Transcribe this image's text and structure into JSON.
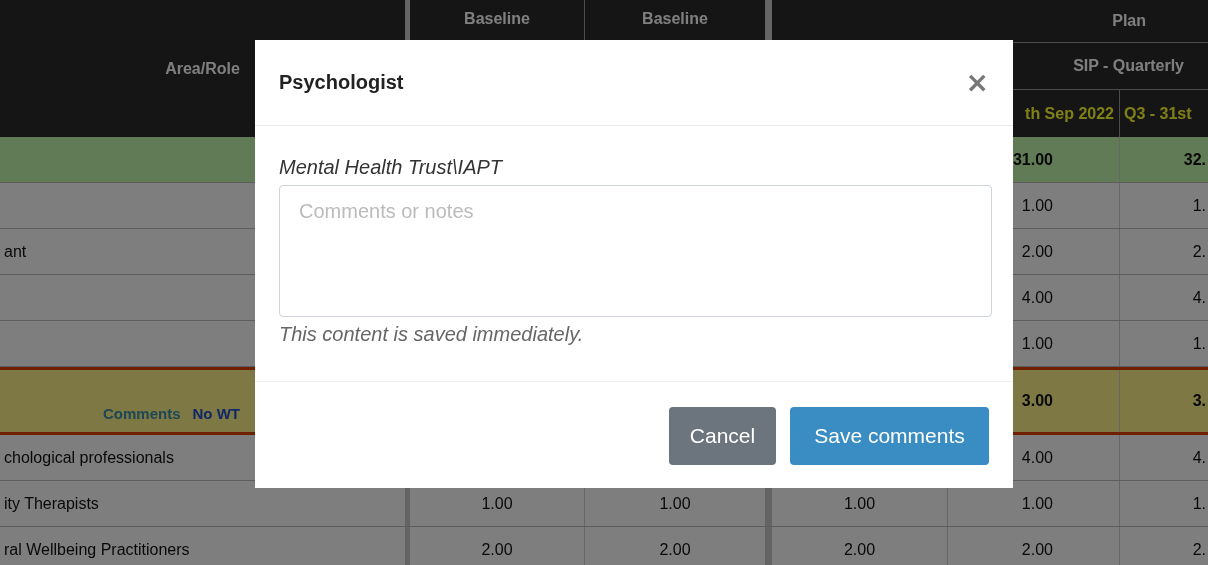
{
  "table": {
    "header": {
      "area_role": "Area/Role",
      "baseline_1": "Baseline",
      "baseline_2": "Baseline",
      "plan": "Plan",
      "plan_period": "SIP - Quarterly",
      "quarter_1": "th Sep 2022",
      "quarter_2": "Q3 - 31st"
    },
    "rows": [
      {
        "kind": "total",
        "cells": {
          "quarter_1": "31.00",
          "quarter_2": "32."
        }
      },
      {
        "kind": "role",
        "cells": {
          "quarter_1": "1.00",
          "quarter_2": "1."
        }
      },
      {
        "kind": "role",
        "role": "ant",
        "cells": {
          "quarter_1": "2.00",
          "quarter_2": "2."
        }
      },
      {
        "kind": "role",
        "cells": {
          "quarter_1": "4.00",
          "quarter_2": "4."
        }
      },
      {
        "kind": "role",
        "cells": {
          "quarter_1": "1.00",
          "quarter_2": "1."
        }
      },
      {
        "kind": "group",
        "links": [
          {
            "label": "Comments",
            "kind": "comments"
          },
          {
            "label": "No WT",
            "kind": "no_wte"
          }
        ],
        "cells": {
          "quarter_1": "3.00",
          "quarter_2": "3."
        }
      },
      {
        "kind": "role",
        "role": "chological professionals",
        "cells": {
          "quarter_1": "4.00",
          "quarter_2": "4."
        }
      },
      {
        "kind": "role",
        "role": "ity Therapists",
        "cells": {
          "baseline_1": "1.00",
          "baseline_2": "1.00",
          "plan_1": "1.00",
          "quarter_1": "1.00",
          "quarter_2": "1."
        }
      },
      {
        "kind": "role",
        "role": "ral Wellbeing Practitioners",
        "cells": {
          "baseline_1": "2.00",
          "baseline_2": "2.00",
          "plan_1": "2.00",
          "quarter_1": "2.00",
          "quarter_2": "2."
        }
      }
    ]
  },
  "modal": {
    "title": "Psychologist",
    "close": "×",
    "subtitle": "Mental Health Trust\\IAPT",
    "comments_placeholder": "Comments or notes",
    "note": "This content is saved immediately.",
    "buttons": [
      {
        "label": "Cancel",
        "kind": "secondary"
      },
      {
        "label": "Save comments",
        "kind": "primary"
      }
    ]
  }
}
